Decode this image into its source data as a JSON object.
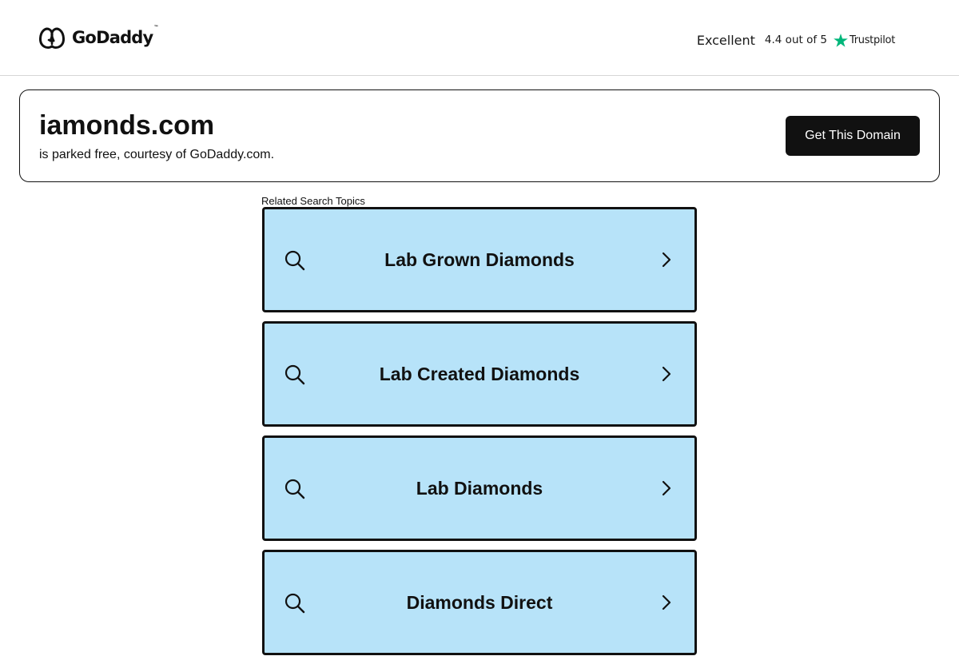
{
  "header": {
    "logo": {
      "icon": "godaddy-logo-icon",
      "text": "GoDaddy",
      "trademark": "™"
    },
    "trustpilot": {
      "rating_word": "Excellent",
      "score_text": "4.4 out of 5",
      "star_icon": "trustpilot-star-icon",
      "brand": "Trustpilot",
      "star_color": "#00b67a"
    }
  },
  "domain_card": {
    "domain": "iamonds.com",
    "subtitle": "is parked free, courtesy of GoDaddy.com.",
    "cta_label": "Get This Domain"
  },
  "related": {
    "label": "Related Search Topics",
    "topics": [
      {
        "label": "Lab Grown Diamonds",
        "left_icon": "search-icon",
        "right_icon": "chevron-right-icon"
      },
      {
        "label": "Lab Created Diamonds",
        "left_icon": "search-icon",
        "right_icon": "chevron-right-icon"
      },
      {
        "label": "Lab Diamonds",
        "left_icon": "search-icon",
        "right_icon": "chevron-right-icon"
      },
      {
        "label": "Diamonds Direct",
        "left_icon": "search-icon",
        "right_icon": "chevron-right-icon"
      }
    ],
    "card_background": "#b7e3f9"
  }
}
